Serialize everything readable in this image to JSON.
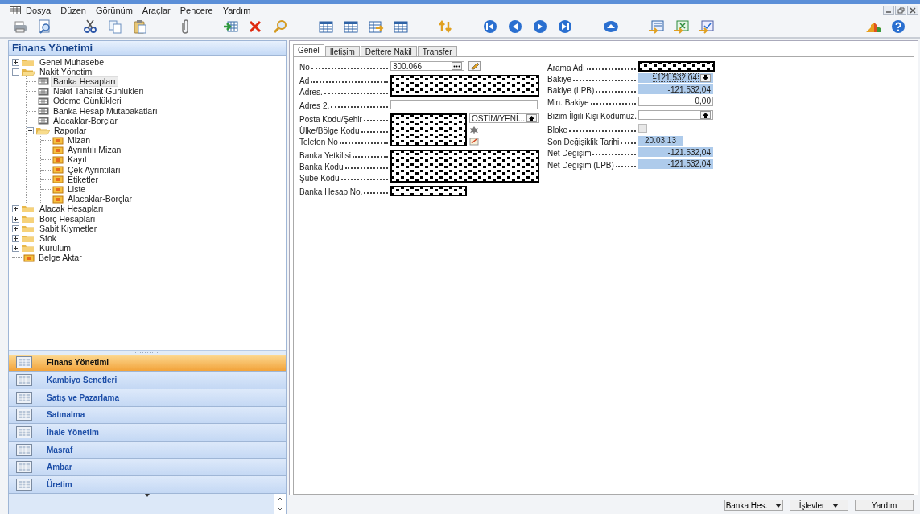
{
  "menu": [
    "Dosya",
    "Düzen",
    "Görünüm",
    "Araçlar",
    "Pencere",
    "Yardım"
  ],
  "navigator": {
    "title": "Finans Yönetimi",
    "tree": [
      {
        "label": "Genel Muhasebe",
        "kind": "folder",
        "expanded": false,
        "selected": false
      },
      {
        "label": "Nakit Yönetimi",
        "kind": "folder",
        "expanded": true,
        "selected": false,
        "children": [
          {
            "label": "Banka Hesapları",
            "kind": "form",
            "selected": true
          },
          {
            "label": "Nakit Tahsilat Günlükleri",
            "kind": "form",
            "selected": false
          },
          {
            "label": "Ödeme Günlükleri",
            "kind": "form",
            "selected": false
          },
          {
            "label": "Banka Hesap Mutabakatları",
            "kind": "form",
            "selected": false
          },
          {
            "label": "Alacaklar-Borçlar",
            "kind": "form",
            "selected": false
          },
          {
            "label": "Raporlar",
            "kind": "folder",
            "expanded": true,
            "selected": false,
            "children": [
              {
                "label": "Mizan",
                "kind": "report",
                "selected": false
              },
              {
                "label": "Ayrıntılı Mizan",
                "kind": "report",
                "selected": false
              },
              {
                "label": "Kayıt",
                "kind": "report",
                "selected": false
              },
              {
                "label": "Çek Ayrıntıları",
                "kind": "report",
                "selected": false
              },
              {
                "label": "Etiketler",
                "kind": "report",
                "selected": false
              },
              {
                "label": "Liste",
                "kind": "report",
                "selected": false
              },
              {
                "label": "Alacaklar-Borçlar",
                "kind": "report",
                "selected": false
              }
            ]
          }
        ]
      },
      {
        "label": "Alacak Hesapları",
        "kind": "folder",
        "expanded": false,
        "selected": false
      },
      {
        "label": "Borç Hesapları",
        "kind": "folder",
        "expanded": false,
        "selected": false
      },
      {
        "label": "Sabit Kıymetler",
        "kind": "folder",
        "expanded": false,
        "selected": false
      },
      {
        "label": "Stok",
        "kind": "folder",
        "expanded": false,
        "selected": false
      },
      {
        "label": "Kurulum",
        "kind": "folder",
        "expanded": false,
        "selected": false
      },
      {
        "label": "Belge Aktar",
        "kind": "report",
        "selected": false
      }
    ],
    "modules": [
      {
        "label": "Finans Yönetimi",
        "selected": true
      },
      {
        "label": "Kambiyo Senetleri",
        "selected": false
      },
      {
        "label": "Satış ve Pazarlama",
        "selected": false
      },
      {
        "label": "Satınalma",
        "selected": false
      },
      {
        "label": "İhale Yönetim",
        "selected": false
      },
      {
        "label": "Masraf",
        "selected": false
      },
      {
        "label": "Ambar",
        "selected": false
      },
      {
        "label": "Üretim",
        "selected": false
      }
    ]
  },
  "tabs": [
    {
      "label": "Genel",
      "selected": true
    },
    {
      "label": "İletişim",
      "selected": false
    },
    {
      "label": "Deftere Nakil",
      "selected": false
    },
    {
      "label": "Transfer",
      "selected": false
    }
  ],
  "left_groups": [
    {
      "kind": "lookup",
      "labels": [
        "No"
      ],
      "value": "300.066"
    },
    {
      "kind": "redacted",
      "labels": [
        "Ad",
        "Adres."
      ]
    },
    {
      "kind": "text",
      "labels": [
        "Adres 2."
      ]
    },
    {
      "kind": "redacted_side",
      "labels": [
        "Posta Kodu/Şehir",
        "Ülke/Bölge Kodu",
        "Telefon No"
      ],
      "side_value": "OSTİM/YENİ..."
    },
    {
      "kind": "redacted",
      "labels": [
        "Banka Yetkilisi",
        "Banka Kodu",
        "Şube Kodu"
      ]
    },
    {
      "kind": "redacted_short",
      "labels": [
        "Banka Hesap No."
      ]
    }
  ],
  "right_fields": [
    {
      "label": "Arama Adı",
      "kind": "redacted"
    },
    {
      "label": "Bakiye",
      "kind": "drilldown",
      "value": "-121.532,04",
      "editable": false
    },
    {
      "label": "Bakiye (LPB)",
      "kind": "amount",
      "value": "-121.532,04",
      "editable": false
    },
    {
      "label": "Min. Bakiye",
      "kind": "amount",
      "value": "0,00",
      "editable": true
    },
    {
      "label": "Bizim İlgili Kişi Kodumuz.",
      "kind": "lookup",
      "editable": true
    },
    {
      "label": "Bloke",
      "kind": "checkbox",
      "checked": false
    },
    {
      "label": "Son Değişiklik Tarihi",
      "kind": "date",
      "value": "20.03.13",
      "editable": false
    },
    {
      "label": "Net Değişim",
      "kind": "amount",
      "value": "-121.532,04",
      "editable": false
    },
    {
      "label": "Net Değişim (LPB)",
      "kind": "amount",
      "value": "-121.532,04",
      "editable": false
    }
  ],
  "footer_buttons": [
    {
      "label": "Banka Hes.",
      "kind": "menu"
    },
    {
      "label": "İşlevler",
      "kind": "menu"
    },
    {
      "label": "Yardım",
      "kind": "button"
    }
  ]
}
